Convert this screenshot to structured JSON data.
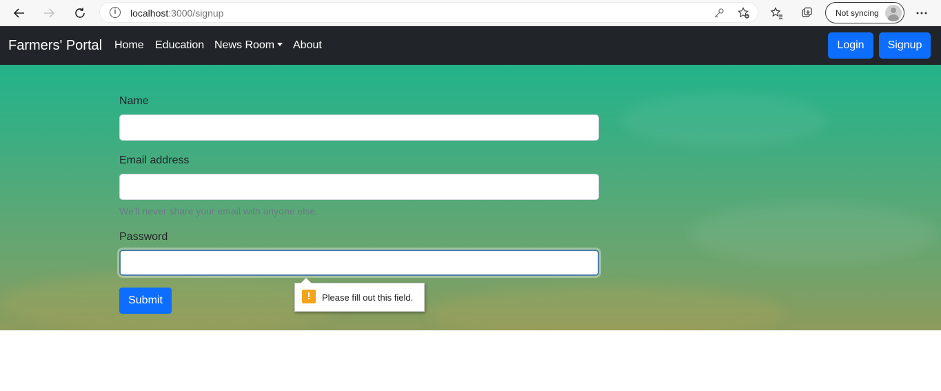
{
  "browser": {
    "back_icon": "arrow-left-icon",
    "forward_icon": "arrow-right-icon",
    "refresh_icon": "refresh-icon",
    "url_host": "localhost",
    "url_path": ":3000/signup",
    "sync_label": "Not syncing"
  },
  "navbar": {
    "brand": "Farmers' Portal",
    "links": [
      "Home",
      "Education",
      "News Room",
      "About"
    ],
    "login_label": "Login",
    "signup_label": "Signup"
  },
  "form": {
    "name_label": "Name",
    "name_value": "",
    "email_label": "Email address",
    "email_value": "",
    "email_help": "We'll never share your email with anyone else.",
    "password_label": "Password",
    "password_value": "",
    "submit_label": "Submit"
  },
  "validation": {
    "message": "Please fill out this field."
  },
  "colors": {
    "navbar_bg": "#212529",
    "primary": "#0d6efd",
    "warning": "#f3a41b"
  }
}
